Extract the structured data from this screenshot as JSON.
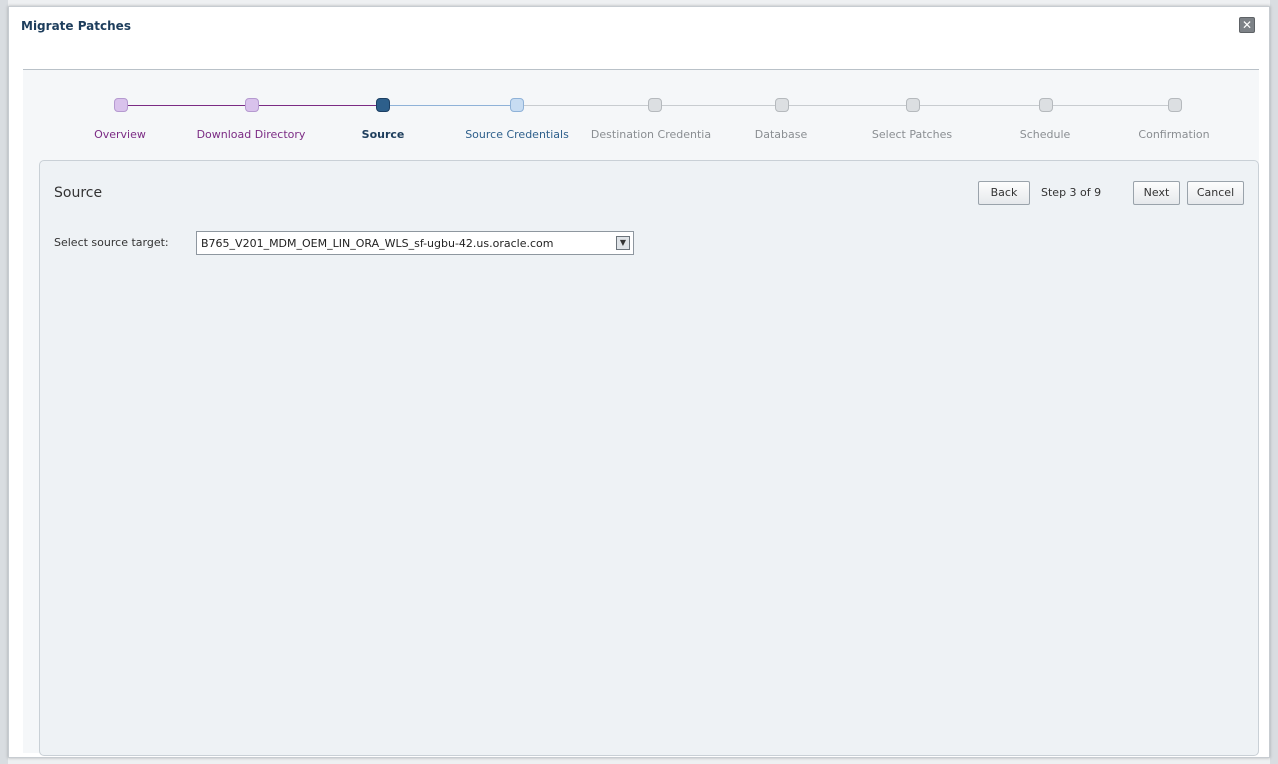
{
  "dialog": {
    "title": "Migrate Patches",
    "close_icon": "close-icon"
  },
  "train": {
    "stops": [
      {
        "label": "Overview",
        "state": "visited"
      },
      {
        "label": "Download Directory",
        "state": "visited"
      },
      {
        "label": "Source",
        "state": "current"
      },
      {
        "label": "Source Credentials",
        "state": "next"
      },
      {
        "label": "Destination Credentia",
        "state": "future"
      },
      {
        "label": "Database",
        "state": "future"
      },
      {
        "label": "Select Patches",
        "state": "future"
      },
      {
        "label": "Schedule",
        "state": "future"
      },
      {
        "label": "Confirmation",
        "state": "future"
      }
    ],
    "colors": {
      "visited": "#7b2b84",
      "current": "#2d5f8b",
      "next_line": "#8fb2d8",
      "future_line": "#c8ccd0"
    }
  },
  "panel": {
    "title": "Source",
    "back_label": "Back",
    "step_text": "Step 3 of 9",
    "next_label": "Next",
    "cancel_label": "Cancel",
    "field_label": "Select source target:",
    "select_value": "B765_V201_MDM_OEM_LIN_ORA_WLS_sf-ugbu-42.us.oracle.com",
    "select_icon": "dropdown-arrow-icon"
  }
}
